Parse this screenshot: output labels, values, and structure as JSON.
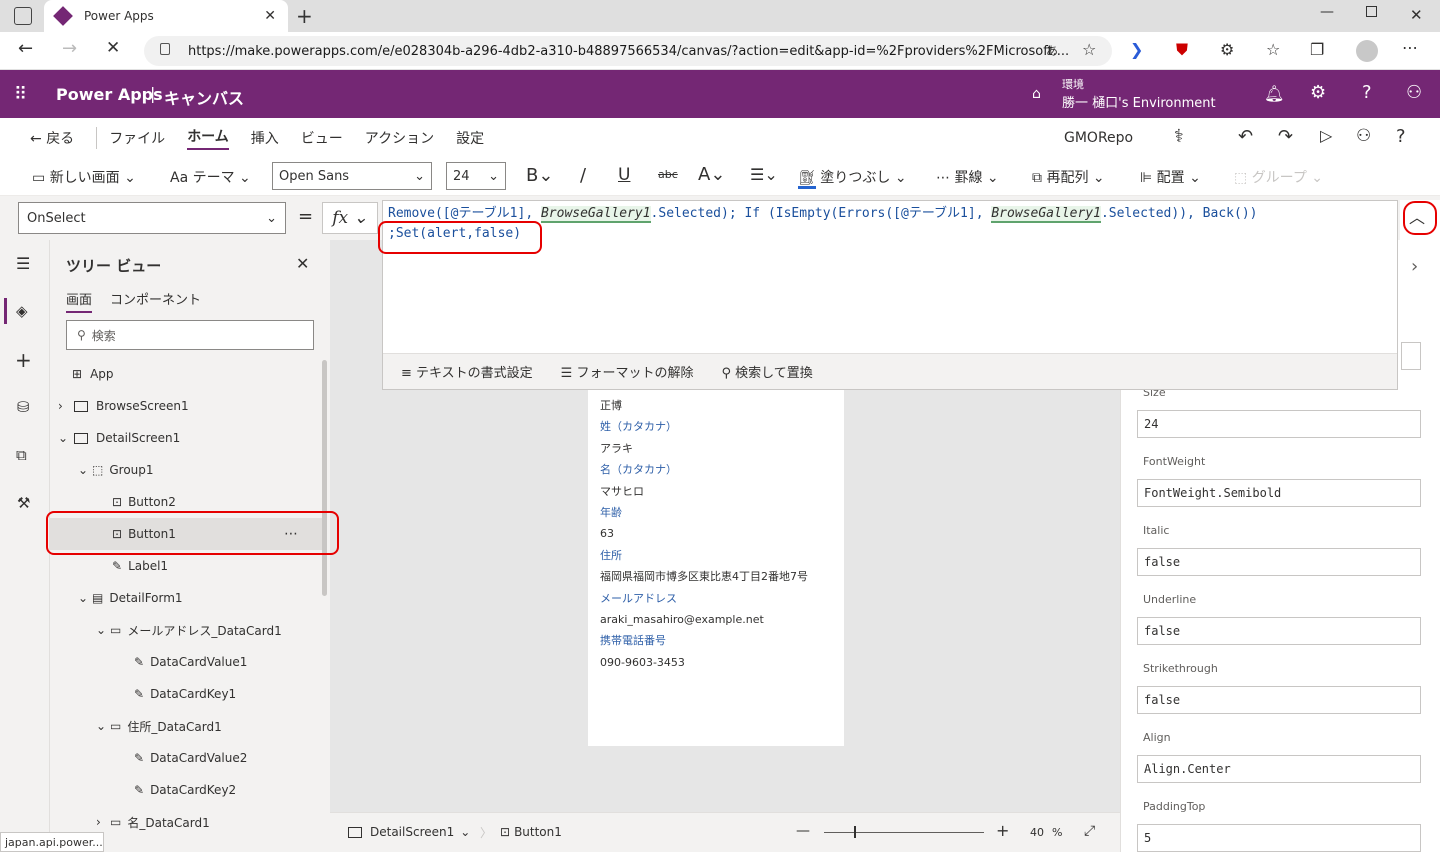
{
  "browser": {
    "tab_title": "Power Apps",
    "url": "https://make.powerapps.com/e/e028304b-a296-4db2-a310-b48897566534/canvas/?action=edit&app-id=%2Fproviders%2FMicrosoft....",
    "status": "japan.api.power..."
  },
  "header": {
    "app": "Power Apps",
    "sep": "|",
    "studio": "キャンバス",
    "env_label": "環境",
    "env_name": "勝一 樋口's Environment"
  },
  "menu": {
    "back": "戻る",
    "items": [
      "ファイル",
      "ホーム",
      "挿入",
      "ビュー",
      "アクション",
      "設定"
    ],
    "active": "ホーム",
    "repo": "GMORepo"
  },
  "toolbar": {
    "new_screen": "新しい画面",
    "theme": "テーマ",
    "font": "Open Sans",
    "size": "24",
    "fill": "塗りつぶし",
    "border": "罫線",
    "reorder": "再配列",
    "align": "配置",
    "group": "グループ"
  },
  "formula": {
    "property": "OnSelect",
    "line1_a": "Remove([@テーブル1], ",
    "line1_b": "BrowseGallery1",
    ".": "",
    "line1_c": ".Selected); If (IsEmpty(Errors([@テーブル1], ",
    "line1_d": "BrowseGallery1",
    "line1_e": ".Selected)), Back())",
    "line2": ";Set(alert,false)",
    "fmt_text": "テキストの書式設定",
    "fmt_clear": "フォーマットの解除",
    "find": "検索して置換"
  },
  "tree": {
    "title": "ツリー ビュー",
    "tab_screens": "画面",
    "tab_components": "コンポーネント",
    "search_ph": "検索",
    "items": [
      "App",
      "BrowseScreen1",
      "DetailScreen1",
      "Group1",
      "Button2",
      "Button1",
      "Label1",
      "DetailForm1",
      "メールアドレス_DataCard1",
      "DataCardValue1",
      "DataCardKey1",
      "住所_DataCard1",
      "DataCardValue2",
      "DataCardKey2",
      "名_DataCard1"
    ]
  },
  "screen": {
    "top": "正博",
    "f1": "姓（カタカナ）",
    "v1": "アラキ",
    "f2": "名（カタカナ）",
    "v2": "マサヒロ",
    "f3": "年齢",
    "v3": "63",
    "f4": "住所",
    "v4": "福岡県福岡市博多区東比恵4丁目2番地7号",
    "f5": "メールアドレス",
    "v5": "araki_masahiro@example.net",
    "f6": "携帯電話番号",
    "v6": "090-9603-3453"
  },
  "bottom": {
    "screen": "DetailScreen1",
    "control": "Button1",
    "zoom": "40",
    "pct": "%"
  },
  "props": [
    {
      "label": "Size",
      "value": "24"
    },
    {
      "label": "FontWeight",
      "value": "FontWeight.Semibold"
    },
    {
      "label": "Italic",
      "value": "false"
    },
    {
      "label": "Underline",
      "value": "false"
    },
    {
      "label": "Strikethrough",
      "value": "false"
    },
    {
      "label": "Align",
      "value": "Align.Center"
    },
    {
      "label": "PaddingTop",
      "value": "5"
    }
  ],
  "colors": {
    "brand": "#742774",
    "accent": "#e60000",
    "formula_blue": "#0b5cad",
    "formula_fn": "#1a4f9c"
  }
}
